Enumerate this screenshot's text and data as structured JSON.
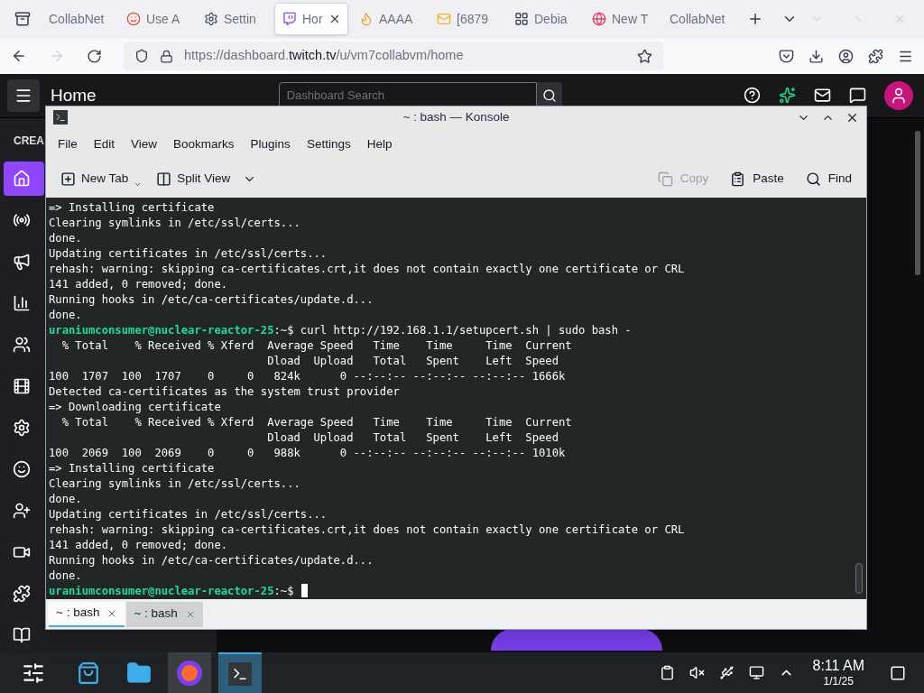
{
  "browser": {
    "tabs": [
      {
        "label": "CollabNet",
        "selected": false
      },
      {
        "label": "Use A",
        "selected": false
      },
      {
        "label": "Settin",
        "selected": false
      },
      {
        "label": "Hor",
        "selected": true
      },
      {
        "label": "AAAA",
        "selected": false
      },
      {
        "label": "[6879",
        "selected": false
      },
      {
        "label": "Debia",
        "selected": false
      },
      {
        "label": "New T",
        "selected": false
      },
      {
        "label": "CollabNet",
        "selected": false
      }
    ],
    "url_prefix": "https://dashboard.",
    "url_domain": "twitch.tv",
    "url_path": "/u/vm7collabvm/home"
  },
  "dashboard": {
    "title": "Home",
    "search": {
      "placeholder": "Dashboard Search"
    },
    "sidebar_heading": "CREA",
    "sidebar_items": [
      {
        "selected": true
      },
      {
        "selected": false
      },
      {
        "selected": false
      },
      {
        "selected": false
      },
      {
        "selected": false
      },
      {
        "selected": false
      },
      {
        "selected": false
      },
      {
        "selected": false
      },
      {
        "selected": false
      },
      {
        "selected": false
      },
      {
        "selected": false
      },
      {
        "selected": false
      }
    ]
  },
  "konsole": {
    "title": "~ : bash — Konsole",
    "menu": [
      "File",
      "Edit",
      "View",
      "Bookmarks",
      "Plugins",
      "Settings",
      "Help"
    ],
    "toolbar_left": [
      {
        "label": "New Tab",
        "disabled": false
      },
      {
        "label": "Split View",
        "disabled": false
      }
    ],
    "toolbar_right": [
      {
        "label": "Copy",
        "disabled": true
      },
      {
        "label": "Paste",
        "disabled": false
      },
      {
        "label": "Find",
        "disabled": false
      }
    ],
    "lines": [
      {
        "kind": "output",
        "text": "=> Installing certificate"
      },
      {
        "kind": "output",
        "text": "Clearing symlinks in /etc/ssl/certs..."
      },
      {
        "kind": "output",
        "text": "done."
      },
      {
        "kind": "output",
        "text": "Updating certificates in /etc/ssl/certs..."
      },
      {
        "kind": "output",
        "text": "rehash: warning: skipping ca-certificates.crt,it does not contain exactly one certificate or CRL"
      },
      {
        "kind": "output",
        "text": "141 added, 0 removed; done."
      },
      {
        "kind": "output",
        "text": "Running hooks in /etc/ca-certificates/update.d..."
      },
      {
        "kind": "output",
        "text": "done."
      },
      {
        "kind": "prompt",
        "user": "uraniumconsumer@nuclear-reactor-25",
        "path": ":~$",
        "text": "curl http://192.168.1.1/setupcert.sh | sudo bash -"
      },
      {
        "kind": "output",
        "text": "  % Total    % Received % Xferd  Average Speed   Time    Time     Time  Current"
      },
      {
        "kind": "output",
        "text": "                                 Dload  Upload   Total   Spent    Left  Speed"
      },
      {
        "kind": "output",
        "text": "100  1707  100  1707    0     0   824k      0 --:--:-- --:--:-- --:--:-- 1666k"
      },
      {
        "kind": "output",
        "text": "Detected ca-certificates as the system trust provider"
      },
      {
        "kind": "output",
        "text": "=> Downloading certificate"
      },
      {
        "kind": "output",
        "text": "  % Total    % Received % Xferd  Average Speed   Time    Time     Time  Current"
      },
      {
        "kind": "output",
        "text": "                                 Dload  Upload   Total   Spent    Left  Speed"
      },
      {
        "kind": "output",
        "text": "100  2069  100  2069    0     0   988k      0 --:--:-- --:--:-- --:--:-- 1010k"
      },
      {
        "kind": "output",
        "text": "=> Installing certificate"
      },
      {
        "kind": "output",
        "text": "Clearing symlinks in /etc/ssl/certs..."
      },
      {
        "kind": "output",
        "text": "done."
      },
      {
        "kind": "output",
        "text": "Updating certificates in /etc/ssl/certs..."
      },
      {
        "kind": "output",
        "text": "rehash: warning: skipping ca-certificates.crt,it does not contain exactly one certificate or CRL"
      },
      {
        "kind": "output",
        "text": "141 added, 0 removed; done."
      },
      {
        "kind": "output",
        "text": "Running hooks in /etc/ca-certificates/update.d..."
      },
      {
        "kind": "output",
        "text": "done."
      },
      {
        "kind": "prompt",
        "user": "uraniumconsumer@nuclear-reactor-25",
        "path": ":~$"
      }
    ],
    "tabs": [
      {
        "label": "~ : bash",
        "selected": true
      },
      {
        "label": "~ : bash",
        "selected": false
      }
    ]
  },
  "taskbar": {
    "time": "8:11 AM",
    "date": "1/1/25"
  }
}
